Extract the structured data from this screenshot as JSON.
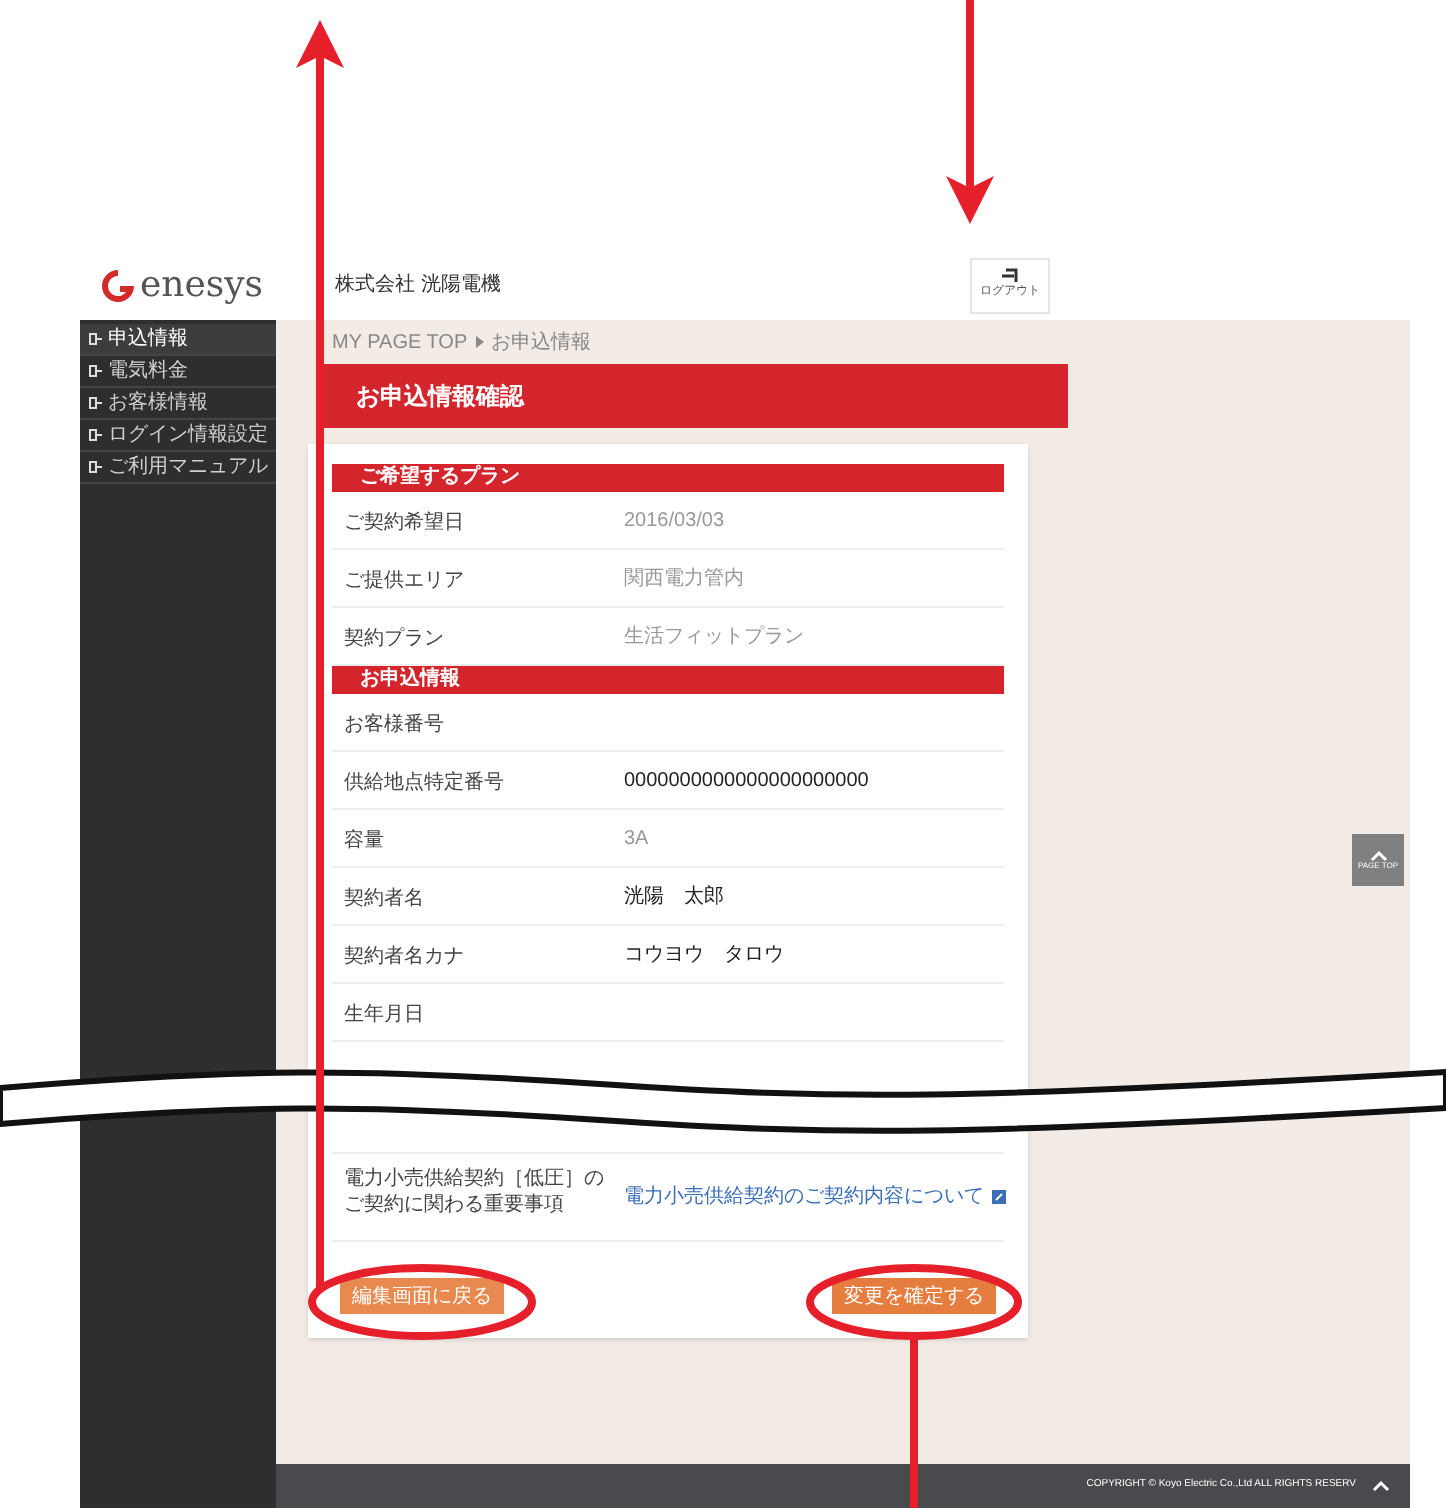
{
  "header": {
    "logo_text": "enesys",
    "company": "株式会社 洸陽電機",
    "logout": "ログアウト"
  },
  "sidebar": {
    "items": [
      {
        "label": "申込情報",
        "selected": true
      },
      {
        "label": "電気料金",
        "selected": false
      },
      {
        "label": "お客様情報",
        "selected": false
      },
      {
        "label": "ログイン情報設定",
        "selected": false
      },
      {
        "label": "ご利用マニュアル",
        "selected": false
      }
    ]
  },
  "breadcrumb": [
    "MY PAGE TOP",
    "お申込情報"
  ],
  "page_title": "お申込情報確認",
  "sections": [
    {
      "title": "ご希望するプラン",
      "rows": [
        {
          "label": "ご契約希望日",
          "value": "2016/03/03"
        },
        {
          "label": "ご提供エリア",
          "value": "関西電力管内"
        },
        {
          "label": "契約プラン",
          "value": "生活フィットプラン"
        }
      ]
    },
    {
      "title": "お申込情報",
      "rows": [
        {
          "label": "お客様番号"
        },
        {
          "label": "供給地点特定番号",
          "value": "0000000000000000000000",
          "strong": true
        },
        {
          "label": "容量",
          "value": "3A"
        },
        {
          "label": "契約者名",
          "value": "洸陽　太郎",
          "strong": true
        },
        {
          "label": "契約者名カナ",
          "value": "コウヨウ　タロウ",
          "strong": true
        },
        {
          "label": "生年月日"
        },
        {
          "label": "",
          "kind": "hidden"
        },
        {
          "label": "電力小売供給契約［低圧］のご契約に関わる重要事項",
          "link": "電力小売供給契約のご契約内容について"
        }
      ]
    }
  ],
  "buttons": [
    {
      "label": "編集画面に戻る",
      "kind": "back"
    },
    {
      "label": "変更を確定する",
      "kind": "confirm"
    }
  ],
  "page_top": "PAGE TOP",
  "footer": "COPYRIGHT © Koyo Electric Co.,Ltd ALL RIGHTS RESERV"
}
